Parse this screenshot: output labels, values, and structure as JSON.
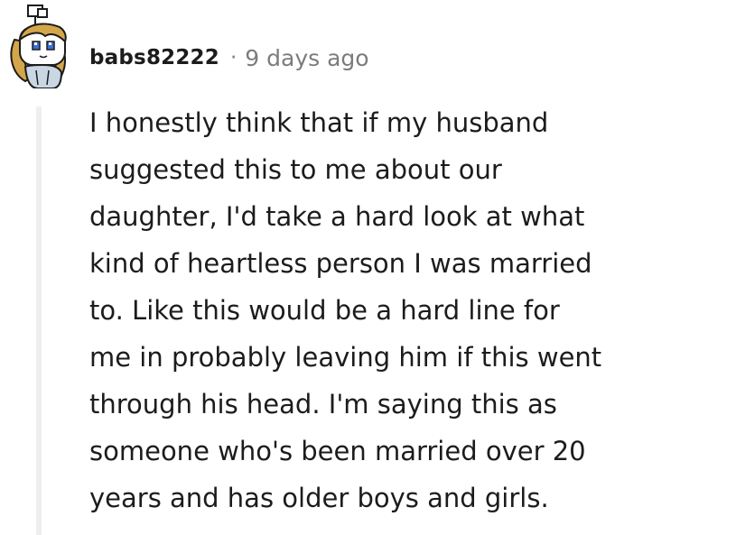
{
  "comment": {
    "avatar": {
      "icon": "snoo-avatar-icon",
      "hair_color": "#d4a64a",
      "eye_color": "#3b6fd1"
    },
    "author": "babs82222",
    "separator": "·",
    "time": "9 days ago",
    "body_lines": [
      "I honestly think that if my husband",
      "suggested this to me about our",
      "daughter, I'd take a hard look at what",
      "kind of heartless person I was married",
      "to. Like this would be a hard line for",
      "me in probably leaving him if this went",
      "through his head. I'm saying this as",
      "someone who's been married over 20",
      "years and has older boys and girls."
    ]
  }
}
